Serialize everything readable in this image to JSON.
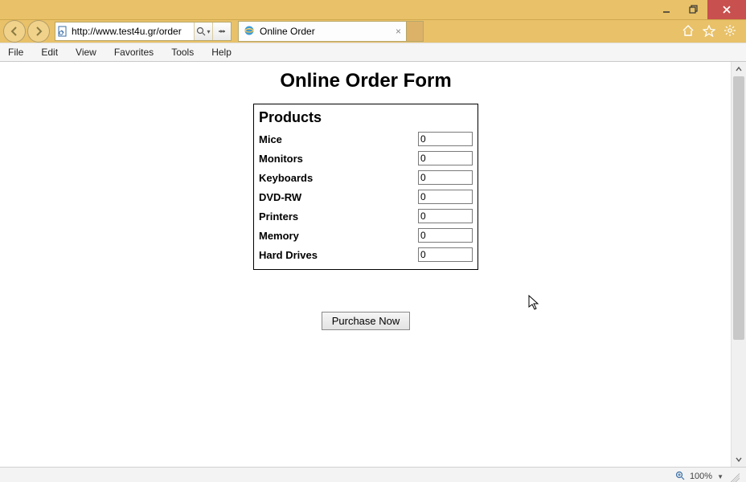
{
  "window": {
    "url": "http://www.test4u.gr/order",
    "tab_title": "Online Order"
  },
  "menu": {
    "items": [
      "File",
      "Edit",
      "View",
      "Favorites",
      "Tools",
      "Help"
    ]
  },
  "page": {
    "title": "Online Order Form",
    "products_heading": "Products",
    "products": [
      {
        "label": "Mice",
        "value": "0"
      },
      {
        "label": "Monitors",
        "value": "0"
      },
      {
        "label": "Keyboards",
        "value": "0"
      },
      {
        "label": "DVD-RW",
        "value": "0"
      },
      {
        "label": "Printers",
        "value": "0"
      },
      {
        "label": "Memory",
        "value": "0"
      },
      {
        "label": "Hard Drives",
        "value": "0"
      }
    ],
    "purchase_label": "Purchase Now"
  },
  "status": {
    "zoom": "100%"
  }
}
